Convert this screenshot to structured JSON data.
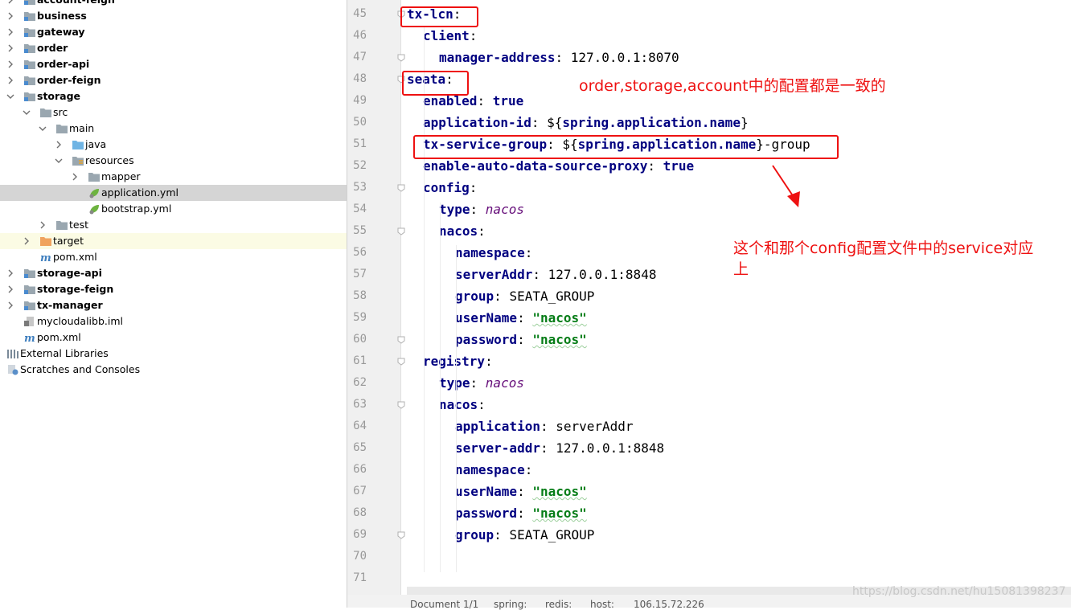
{
  "project_tree": [
    {
      "label": "account-feign",
      "bold": true,
      "arrow": "right",
      "icon": "module-folder-icon",
      "indent": 0
    },
    {
      "label": "business",
      "bold": true,
      "arrow": "right",
      "icon": "module-folder-icon",
      "indent": 0
    },
    {
      "label": "gateway",
      "bold": true,
      "arrow": "right",
      "icon": "module-folder-icon",
      "indent": 0
    },
    {
      "label": "order",
      "bold": true,
      "arrow": "right",
      "icon": "module-folder-icon",
      "indent": 0
    },
    {
      "label": "order-api",
      "bold": true,
      "arrow": "right",
      "icon": "module-folder-icon",
      "indent": 0
    },
    {
      "label": "order-feign",
      "bold": true,
      "arrow": "right",
      "icon": "module-folder-icon",
      "indent": 0
    },
    {
      "label": "storage",
      "bold": true,
      "arrow": "down",
      "icon": "module-folder-icon",
      "indent": 0
    },
    {
      "label": "src",
      "bold": false,
      "arrow": "down",
      "icon": "folder-icon",
      "indent": 1
    },
    {
      "label": "main",
      "bold": false,
      "arrow": "down",
      "icon": "folder-icon",
      "indent": 2
    },
    {
      "label": "java",
      "bold": false,
      "arrow": "right",
      "icon": "source-folder-icon",
      "indent": 3
    },
    {
      "label": "resources",
      "bold": false,
      "arrow": "down",
      "icon": "resources-folder-icon",
      "indent": 3
    },
    {
      "label": "mapper",
      "bold": false,
      "arrow": "right",
      "icon": "folder-icon",
      "indent": 4
    },
    {
      "label": "application.yml",
      "bold": false,
      "arrow": "none",
      "icon": "spring-yml-icon",
      "indent": 4,
      "selected": true
    },
    {
      "label": "bootstrap.yml",
      "bold": false,
      "arrow": "none",
      "icon": "spring-yml-icon",
      "indent": 4
    },
    {
      "label": "test",
      "bold": false,
      "arrow": "right",
      "icon": "folder-icon",
      "indent": 2
    },
    {
      "label": "target",
      "bold": false,
      "arrow": "right",
      "icon": "excluded-folder-icon",
      "indent": 1,
      "excluded": true
    },
    {
      "label": "pom.xml",
      "bold": false,
      "arrow": "none",
      "icon": "maven-icon",
      "indent": 1
    },
    {
      "label": "storage-api",
      "bold": true,
      "arrow": "right",
      "icon": "module-folder-icon",
      "indent": 0
    },
    {
      "label": "storage-feign",
      "bold": true,
      "arrow": "right",
      "icon": "module-folder-icon",
      "indent": 0
    },
    {
      "label": "tx-manager",
      "bold": true,
      "arrow": "right",
      "icon": "module-folder-icon",
      "indent": 0
    },
    {
      "label": "mycloudalibb.iml",
      "bold": false,
      "arrow": "none",
      "icon": "iml-file-icon",
      "indent": 0
    },
    {
      "label": "pom.xml",
      "bold": false,
      "arrow": "none",
      "icon": "maven-icon",
      "indent": 0
    },
    {
      "label": "External Libraries",
      "bold": false,
      "arrow": "none",
      "icon": "libraries-icon",
      "indent": -1
    },
    {
      "label": "Scratches and Consoles",
      "bold": false,
      "arrow": "none",
      "icon": "scratches-icon",
      "indent": -1
    }
  ],
  "editor": {
    "lines": [
      {
        "n": "45",
        "indent": 0,
        "fold": true,
        "tokens": [
          {
            "t": "tx-lcn",
            "c": "k"
          },
          {
            "t": ":",
            "c": "v"
          }
        ]
      },
      {
        "n": "46",
        "indent": 1,
        "fold": false,
        "tokens": [
          {
            "t": "client",
            "c": "k"
          },
          {
            "t": ":",
            "c": "v"
          }
        ]
      },
      {
        "n": "47",
        "indent": 2,
        "fold": true,
        "tokens": [
          {
            "t": "manager-address",
            "c": "k"
          },
          {
            "t": ": 127.0.0.1:8070",
            "c": "v"
          }
        ]
      },
      {
        "n": "48",
        "indent": 0,
        "fold": true,
        "tokens": [
          {
            "t": "seata",
            "c": "k"
          },
          {
            "t": ":",
            "c": "v"
          }
        ]
      },
      {
        "n": "49",
        "indent": 1,
        "fold": false,
        "tokens": [
          {
            "t": "enabled",
            "c": "k"
          },
          {
            "t": ": ",
            "c": "v"
          },
          {
            "t": "true",
            "c": "k"
          }
        ]
      },
      {
        "n": "50",
        "indent": 1,
        "fold": false,
        "tokens": [
          {
            "t": "application-id",
            "c": "k"
          },
          {
            "t": ": ${",
            "c": "v"
          },
          {
            "t": "spring.application.name",
            "c": "k"
          },
          {
            "t": "}",
            "c": "v"
          }
        ]
      },
      {
        "n": "51",
        "indent": 1,
        "fold": false,
        "tokens": [
          {
            "t": "tx-service-group",
            "c": "k"
          },
          {
            "t": ": ${",
            "c": "v"
          },
          {
            "t": "spring.application.name",
            "c": "k"
          },
          {
            "t": "}-group",
            "c": "v"
          }
        ]
      },
      {
        "n": "52",
        "indent": 1,
        "fold": false,
        "tokens": [
          {
            "t": "enable-auto-data-source-proxy",
            "c": "k"
          },
          {
            "t": ": ",
            "c": "v"
          },
          {
            "t": "true",
            "c": "k"
          }
        ]
      },
      {
        "n": "53",
        "indent": 1,
        "fold": true,
        "tokens": [
          {
            "t": "config",
            "c": "k"
          },
          {
            "t": ":",
            "c": "v"
          }
        ]
      },
      {
        "n": "54",
        "indent": 2,
        "fold": false,
        "tokens": [
          {
            "t": "type",
            "c": "k"
          },
          {
            "t": ": ",
            "c": "v"
          },
          {
            "t": "nacos",
            "c": "it"
          }
        ]
      },
      {
        "n": "55",
        "indent": 2,
        "fold": true,
        "tokens": [
          {
            "t": "nacos",
            "c": "k"
          },
          {
            "t": ":",
            "c": "v"
          }
        ]
      },
      {
        "n": "56",
        "indent": 3,
        "fold": false,
        "tokens": [
          {
            "t": "namespace",
            "c": "k"
          },
          {
            "t": ":",
            "c": "v"
          }
        ]
      },
      {
        "n": "57",
        "indent": 3,
        "fold": false,
        "tokens": [
          {
            "t": "serverAddr",
            "c": "k"
          },
          {
            "t": ": 127.0.0.1:8848",
            "c": "v"
          }
        ]
      },
      {
        "n": "58",
        "indent": 3,
        "fold": false,
        "tokens": [
          {
            "t": "group",
            "c": "k"
          },
          {
            "t": ": SEATA_GROUP",
            "c": "v"
          }
        ]
      },
      {
        "n": "59",
        "indent": 3,
        "fold": false,
        "tokens": [
          {
            "t": "userName",
            "c": "k"
          },
          {
            "t": ": ",
            "c": "v"
          },
          {
            "t": "\"nacos\"",
            "c": "s sq"
          }
        ]
      },
      {
        "n": "60",
        "indent": 3,
        "fold": true,
        "tokens": [
          {
            "t": "password",
            "c": "k"
          },
          {
            "t": ": ",
            "c": "v"
          },
          {
            "t": "\"nacos\"",
            "c": "s sq"
          }
        ]
      },
      {
        "n": "61",
        "indent": 1,
        "fold": true,
        "tokens": [
          {
            "t": "registry",
            "c": "k"
          },
          {
            "t": ":",
            "c": "v"
          }
        ]
      },
      {
        "n": "62",
        "indent": 2,
        "fold": false,
        "tokens": [
          {
            "t": "type",
            "c": "k"
          },
          {
            "t": ": ",
            "c": "v"
          },
          {
            "t": "nacos",
            "c": "it"
          }
        ]
      },
      {
        "n": "63",
        "indent": 2,
        "fold": true,
        "tokens": [
          {
            "t": "nacos",
            "c": "k"
          },
          {
            "t": ":",
            "c": "v"
          }
        ]
      },
      {
        "n": "64",
        "indent": 3,
        "fold": false,
        "tokens": [
          {
            "t": "application",
            "c": "k"
          },
          {
            "t": ": serverAddr",
            "c": "v"
          }
        ]
      },
      {
        "n": "65",
        "indent": 3,
        "fold": false,
        "tokens": [
          {
            "t": "server-addr",
            "c": "k"
          },
          {
            "t": ": 127.0.0.1:8848",
            "c": "v"
          }
        ]
      },
      {
        "n": "66",
        "indent": 3,
        "fold": false,
        "tokens": [
          {
            "t": "namespace",
            "c": "k"
          },
          {
            "t": ":",
            "c": "v"
          }
        ]
      },
      {
        "n": "67",
        "indent": 3,
        "fold": false,
        "tokens": [
          {
            "t": "userName",
            "c": "k"
          },
          {
            "t": ": ",
            "c": "v"
          },
          {
            "t": "\"nacos\"",
            "c": "s sq"
          }
        ]
      },
      {
        "n": "68",
        "indent": 3,
        "fold": false,
        "tokens": [
          {
            "t": "password",
            "c": "k"
          },
          {
            "t": ": ",
            "c": "v"
          },
          {
            "t": "\"nacos\"",
            "c": "s sq"
          }
        ]
      },
      {
        "n": "69",
        "indent": 3,
        "fold": true,
        "tokens": [
          {
            "t": "group",
            "c": "k"
          },
          {
            "t": ": SEATA_GROUP",
            "c": "v"
          }
        ]
      },
      {
        "n": "70",
        "indent": 0,
        "fold": false,
        "tokens": []
      },
      {
        "n": "71",
        "indent": 0,
        "fold": false,
        "tokens": []
      }
    ]
  },
  "annotations": {
    "note_1": "order,storage,account中的配置都是一致的",
    "note_2_line1": "这个和那个config配置文件中的service对应",
    "note_2_line2": "上",
    "box_color": "#ee1111"
  },
  "status_bar": {
    "document": "Document 1/1",
    "crumb_1": "spring:",
    "crumb_2": "redis:",
    "crumb_3": "host:",
    "crumb_4": "106.15.72.226"
  },
  "watermark": "https://blog.csdn.net/hu15081398237"
}
